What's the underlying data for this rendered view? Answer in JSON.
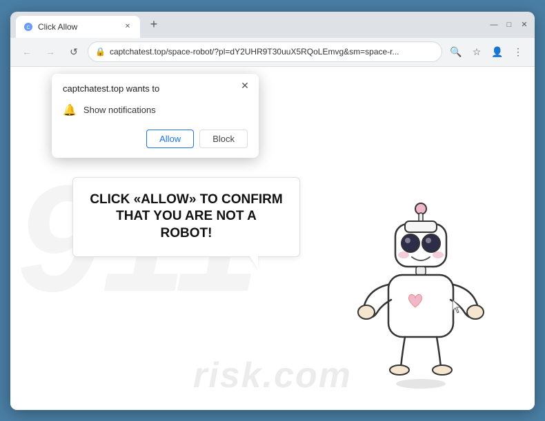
{
  "browser": {
    "title": "Click Allow",
    "tab_label": "Click Allow",
    "url": "captchatest.top/space-robot/?pl=dY2UHR9T30uuX5RQoLEmvg&sm=space-r...",
    "url_full": "captchatest.top/space-robot/?pl=dY2UHR9T30uuX5RQoLEmvg&sm=space-r...",
    "new_tab_label": "+",
    "back_label": "←",
    "forward_label": "→",
    "refresh_label": "↺",
    "minimize_label": "—",
    "maximize_label": "□",
    "close_label": "✕"
  },
  "popup": {
    "title": "captchatest.top wants to",
    "permission_label": "Show notifications",
    "allow_label": "Allow",
    "block_label": "Block",
    "close_label": "✕"
  },
  "page": {
    "message": "CLICK «ALLOW» TO CONFIRM THAT YOU ARE NOT A ROBOT!",
    "watermark_text": "risk.com"
  }
}
